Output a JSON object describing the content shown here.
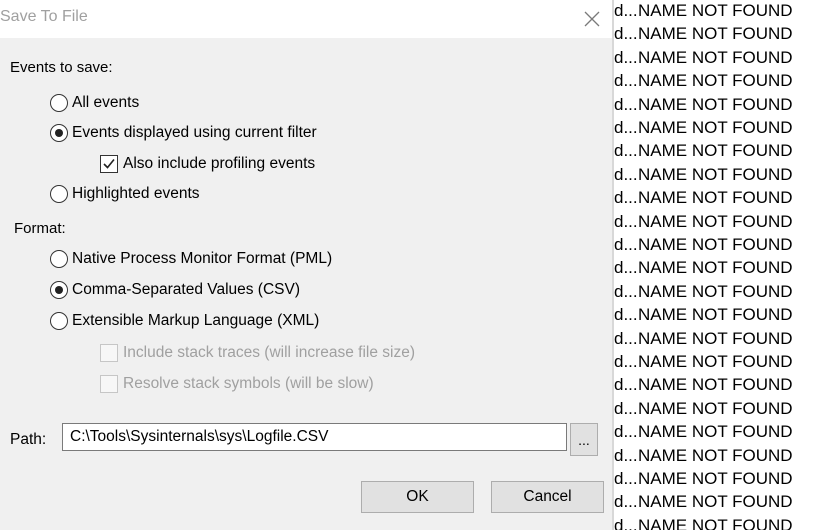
{
  "dialog": {
    "title": "Save To File",
    "close_glyph": "close-icon",
    "events_label": "Events to save:",
    "events_options": [
      {
        "label": "All events",
        "checked": false
      },
      {
        "label": "Events displayed using current filter",
        "checked": true
      },
      {
        "label": "Highlighted events",
        "checked": false
      }
    ],
    "include_profiling": {
      "label": "Also include profiling events",
      "checked": true
    },
    "format_label": "Format:",
    "format_options": [
      {
        "label": "Native Process Monitor Format (PML)",
        "checked": false
      },
      {
        "label": "Comma-Separated Values (CSV)",
        "checked": true
      },
      {
        "label": "Extensible Markup Language (XML)",
        "checked": false
      }
    ],
    "include_stack": {
      "label": "Include stack traces (will increase file size)",
      "checked": false,
      "disabled": true
    },
    "resolve_stack": {
      "label": "Resolve stack symbols (will be slow)",
      "checked": false,
      "disabled": true
    },
    "path_label": "Path:",
    "path_value": "C:\\Tools\\Sysinternals\\sys\\Logfile.CSV",
    "browse_label": "...",
    "ok_label": "OK",
    "cancel_label": "Cancel"
  },
  "background_list": {
    "prefix": "d...",
    "rows": [
      "NAME NOT FOUND",
      "NAME NOT FOUND",
      "NAME NOT FOUND",
      "NAME NOT FOUND",
      "NAME NOT FOUND",
      "NAME NOT FOUND",
      "NAME NOT FOUND",
      "NAME NOT FOUND",
      "NAME NOT FOUND",
      "NAME NOT FOUND",
      "NAME NOT FOUND",
      "NAME NOT FOUND",
      "NAME NOT FOUND",
      "NAME NOT FOUND",
      "NAME NOT FOUND",
      "NAME NOT FOUND",
      "NAME NOT FOUND",
      "NAME NOT FOUND",
      "NAME NOT FOUND",
      "NAME NOT FOUND",
      "NAME NOT FOUND",
      "NAME NOT FOUND",
      "NAME NOT FOUND"
    ]
  }
}
